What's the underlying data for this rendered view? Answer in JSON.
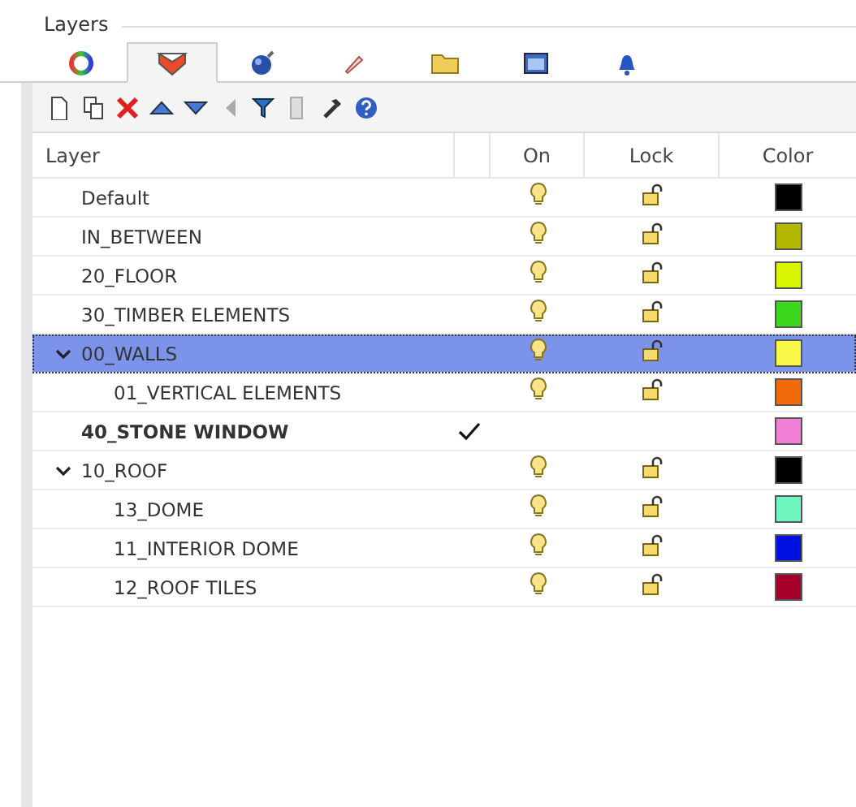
{
  "panel": {
    "title": "Layers"
  },
  "tabs": [
    {
      "selected": false
    },
    {
      "selected": true
    },
    {
      "selected": false
    },
    {
      "selected": false
    },
    {
      "selected": false
    },
    {
      "selected": false
    },
    {
      "selected": false
    }
  ],
  "table": {
    "columns": [
      "Layer",
      "On",
      "Lock",
      "Color"
    ],
    "rows": [
      {
        "name": "Default",
        "current": false,
        "selected": false,
        "on": true,
        "locked": false,
        "color": "#000000"
      },
      {
        "name": "IN_BETWEEN",
        "current": false,
        "selected": false,
        "on": true,
        "locked": false,
        "color": "#b5b800"
      },
      {
        "name": "20_FLOOR",
        "current": false,
        "selected": false,
        "on": true,
        "locked": false,
        "color": "#d9f500"
      },
      {
        "name": "30_TIMBER ELEMENTS",
        "current": false,
        "selected": false,
        "on": true,
        "locked": false,
        "color": "#3cd61a"
      },
      {
        "name": "00_WALLS",
        "current": false,
        "selected": true,
        "on": true,
        "locked": false,
        "color": "#f7f748",
        "expanded": true,
        "children": [
          {
            "name": "01_VERTICAL ELEMENTS",
            "current": false,
            "selected": false,
            "on": true,
            "locked": false,
            "color": "#f26a0a"
          }
        ]
      },
      {
        "name": "40_STONE WINDOW",
        "current": true,
        "selected": false,
        "color": "#f27fd6"
      },
      {
        "name": "10_ROOF",
        "current": false,
        "selected": false,
        "on": true,
        "locked": false,
        "color": "#000000",
        "expanded": true,
        "children": [
          {
            "name": "13_DOME",
            "current": false,
            "selected": false,
            "on": true,
            "locked": false,
            "color": "#6ff5c0"
          },
          {
            "name": "11_INTERIOR DOME",
            "current": false,
            "selected": false,
            "on": true,
            "locked": false,
            "color": "#0010e0"
          },
          {
            "name": "12_ROOF TILES",
            "current": false,
            "selected": false,
            "on": true,
            "locked": false,
            "color": "#a5002a"
          }
        ]
      }
    ]
  }
}
